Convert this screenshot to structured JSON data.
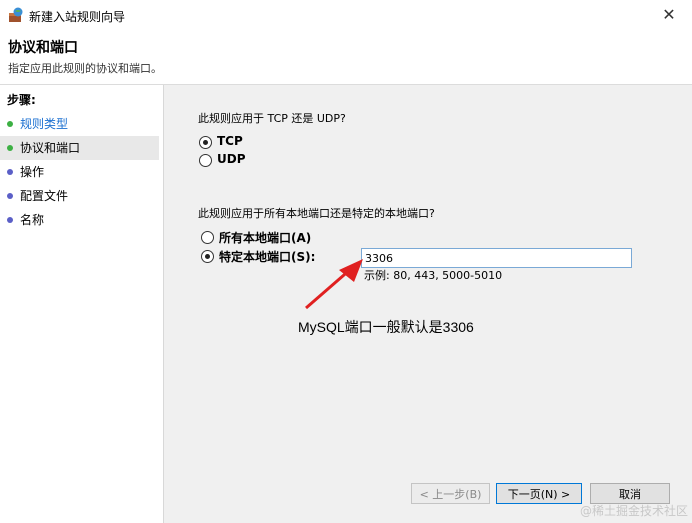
{
  "window": {
    "title": "新建入站规则向导",
    "close_glyph": "✕"
  },
  "header": {
    "title": "协议和端口",
    "description": "指定应用此规则的协议和端口。"
  },
  "steps": {
    "title": "步骤:",
    "items": [
      {
        "label": "规则类型",
        "color": "#1a6fd1",
        "dot_color": "#3cb043"
      },
      {
        "label": "协议和端口",
        "color": "#000000",
        "dot_color": "#3cb043"
      },
      {
        "label": "操作",
        "color": "#000000",
        "dot_color": "#5b5fc7"
      },
      {
        "label": "配置文件",
        "color": "#000000",
        "dot_color": "#5b5fc7"
      },
      {
        "label": "名称",
        "color": "#000000",
        "dot_color": "#5b5fc7"
      }
    ]
  },
  "protocol": {
    "question": "此规则应用于 TCP 还是 UDP?",
    "options": [
      {
        "label": "TCP",
        "selected": true
      },
      {
        "label": "UDP",
        "selected": false
      }
    ]
  },
  "ports": {
    "question": "此规则应用于所有本地端口还是特定的本地端口?",
    "options": [
      {
        "label": "所有本地端口(A)",
        "selected": false
      },
      {
        "label": "特定本地端口(S):",
        "selected": true
      }
    ],
    "value": "3306",
    "example": "示例: 80, 443, 5000-5010"
  },
  "annotation": "MySQL端口一般默认是3306",
  "buttons": {
    "back": "< 上一步(B)",
    "next": "下一页(N) >",
    "cancel": "取消"
  },
  "watermark": "@稀土掘金技术社区"
}
